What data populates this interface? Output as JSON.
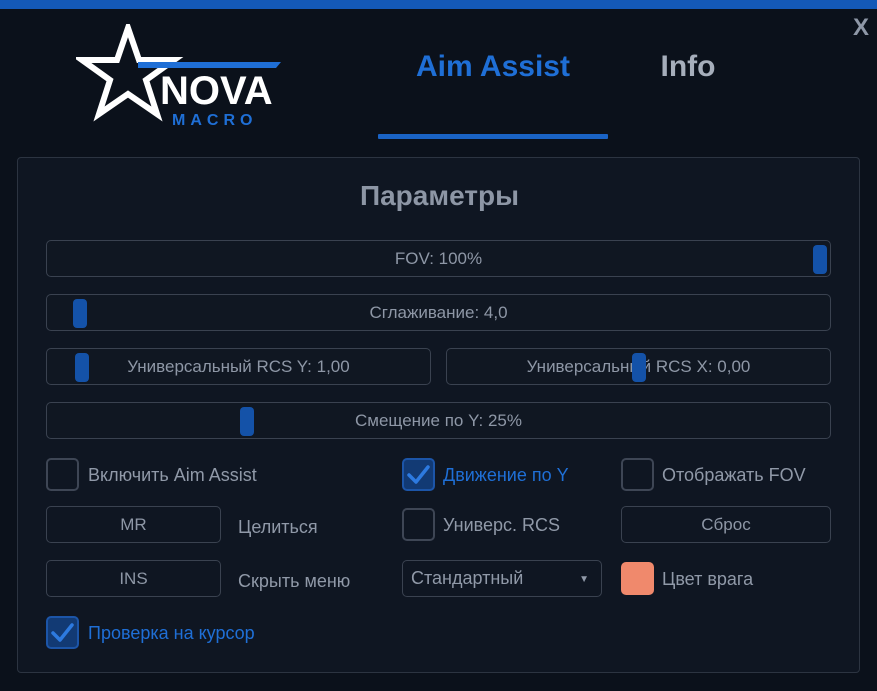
{
  "window": {
    "close_label": "X"
  },
  "logo": {
    "name": "NOVA",
    "sub": "MACRO"
  },
  "tabs": [
    {
      "label": "Aim Assist",
      "active": true
    },
    {
      "label": "Info",
      "active": false
    }
  ],
  "panel": {
    "title": "Параметры",
    "sliders": {
      "fov": {
        "label": "FOV: 100%",
        "value_percent": 100
      },
      "smoothing": {
        "label": "Сглаживание: 4,0",
        "value": 4.0
      },
      "rcs_y": {
        "label": "Универсальный RCS Y: 1,00",
        "value": 1.0
      },
      "rcs_x": {
        "label": "Универсальный RCS X: 0,00",
        "value": 0.0
      },
      "offset_y": {
        "label": "Смещение по Y: 25%",
        "value_percent": 25
      }
    },
    "options": {
      "enable_aim": {
        "label": "Включить Aim Assist",
        "checked": false
      },
      "move_y": {
        "label": "Движение по Y",
        "checked": true
      },
      "show_fov": {
        "label": "Отображать FOV",
        "checked": false
      },
      "univ_rcs": {
        "label": "Универс. RCS",
        "checked": false
      },
      "cursor_check": {
        "label": "Проверка на курсор",
        "checked": true
      }
    },
    "keybinds": {
      "aim_key": {
        "key": "MR",
        "label": "Целиться"
      },
      "hide_key": {
        "key": "INS",
        "label": "Скрыть меню"
      }
    },
    "reset_label": "Сброс",
    "mode_select": {
      "value": "Стандартный"
    },
    "enemy_color": {
      "label": "Цвет врага",
      "color": "#f0896c"
    }
  },
  "colors": {
    "accent": "#1f6fd6",
    "topbar": "#1459b8"
  }
}
